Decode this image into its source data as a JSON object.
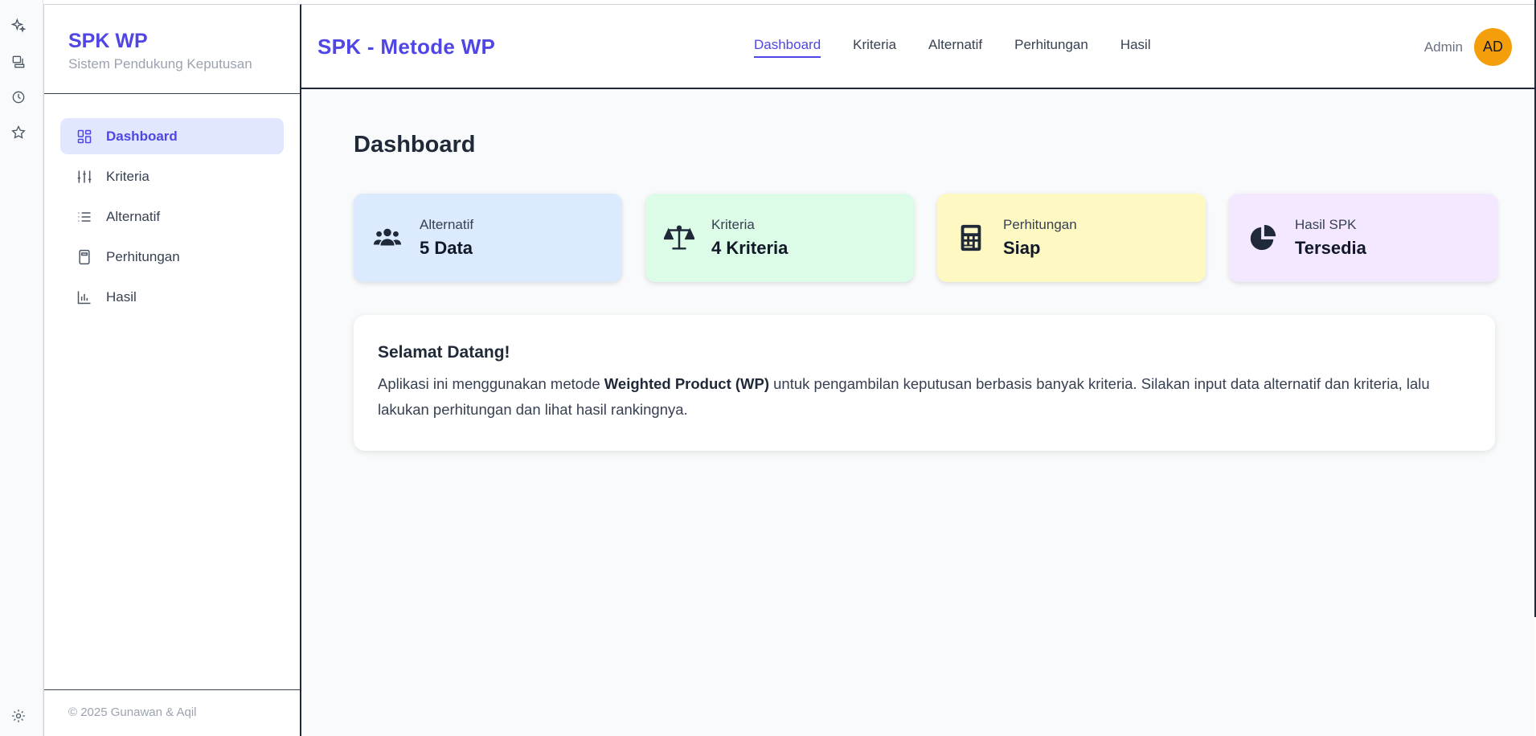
{
  "sidebar": {
    "brand_title": "SPK WP",
    "brand_subtitle": "Sistem Pendukung Keputusan",
    "items": [
      {
        "label": "Dashboard",
        "icon": "dashboard-icon",
        "active": true
      },
      {
        "label": "Kriteria",
        "icon": "sliders-icon",
        "active": false
      },
      {
        "label": "Alternatif",
        "icon": "list-icon",
        "active": false
      },
      {
        "label": "Perhitungan",
        "icon": "calculator-icon",
        "active": false
      },
      {
        "label": "Hasil",
        "icon": "bar-chart-icon",
        "active": false
      }
    ],
    "footer": "© 2025 Gunawan & Aqil"
  },
  "header": {
    "title": "SPK - Metode WP",
    "nav": [
      {
        "label": "Dashboard",
        "active": true
      },
      {
        "label": "Kriteria",
        "active": false
      },
      {
        "label": "Alternatif",
        "active": false
      },
      {
        "label": "Perhitungan",
        "active": false
      },
      {
        "label": "Hasil",
        "active": false
      }
    ],
    "user_name": "Admin",
    "avatar_initials": "AD"
  },
  "main": {
    "page_title": "Dashboard",
    "stats": [
      {
        "label": "Alternatif",
        "value": "5 Data",
        "icon": "users-icon",
        "color": "#dbeafe"
      },
      {
        "label": "Kriteria",
        "value": "4 Kriteria",
        "icon": "balance-scale-icon",
        "color": "#dcfce7"
      },
      {
        "label": "Perhitungan",
        "value": "Siap",
        "icon": "calculator-icon",
        "color": "#fef9c3"
      },
      {
        "label": "Hasil SPK",
        "value": "Tersedia",
        "icon": "pie-chart-icon",
        "color": "#f3e8ff"
      }
    ],
    "welcome": {
      "title": "Selamat Datang!",
      "text_before": "Aplikasi ini menggunakan metode ",
      "text_bold": "Weighted Product (WP)",
      "text_after": " untuk pengambilan keputusan berbasis banyak kriteria. Silakan input data alternatif dan kriteria, lalu lakukan perhitungan dan lihat hasil rankingnya."
    }
  },
  "colors": {
    "accent": "#4f46e5",
    "avatar": "#f59e0b"
  }
}
